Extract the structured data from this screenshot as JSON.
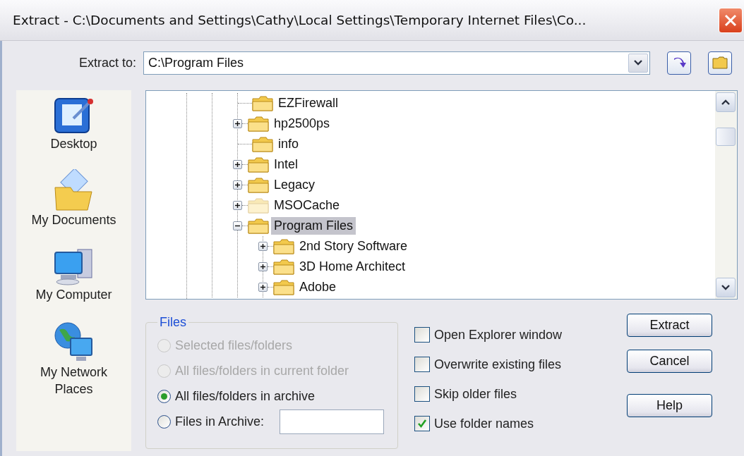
{
  "window": {
    "title": "Extract - C:\\Documents and Settings\\Cathy\\Local Settings\\Temporary Internet Files\\Co..."
  },
  "extract_to": {
    "label": "Extract to:",
    "value": "C:\\Program Files"
  },
  "places": [
    {
      "label": "Desktop",
      "kind": "desktop"
    },
    {
      "label": "My Documents",
      "kind": "documents"
    },
    {
      "label": "My Computer",
      "kind": "computer"
    },
    {
      "label": "My Network Places",
      "kind": "network"
    }
  ],
  "tree": [
    {
      "label": "EZFirewall",
      "expandable": false,
      "selected": false,
      "dimmed": false
    },
    {
      "label": "hp2500ps",
      "expandable": true,
      "expanded": false,
      "selected": false,
      "dimmed": false
    },
    {
      "label": "info",
      "expandable": false,
      "selected": false,
      "dimmed": false
    },
    {
      "label": "Intel",
      "expandable": true,
      "expanded": false,
      "selected": false,
      "dimmed": false
    },
    {
      "label": "Legacy",
      "expandable": true,
      "expanded": false,
      "selected": false,
      "dimmed": false
    },
    {
      "label": "MSOCache",
      "expandable": true,
      "expanded": false,
      "selected": false,
      "dimmed": true
    },
    {
      "label": "Program Files",
      "expandable": true,
      "expanded": true,
      "selected": true,
      "dimmed": false,
      "children": [
        {
          "label": "2nd Story Software",
          "expandable": true,
          "expanded": false,
          "selected": false,
          "dimmed": false
        },
        {
          "label": "3D Home Architect",
          "expandable": true,
          "expanded": false,
          "selected": false,
          "dimmed": false
        },
        {
          "label": "Adobe",
          "expandable": true,
          "expanded": false,
          "selected": false,
          "dimmed": false
        }
      ]
    }
  ],
  "files_group": {
    "title": "Files",
    "options": [
      {
        "label": "Selected files/folders",
        "kind": "plain",
        "selected": false,
        "disabled": true
      },
      {
        "label": "All files/folders in current folder",
        "kind": "plain",
        "selected": false,
        "disabled": true
      },
      {
        "label": "All files/folders in archive",
        "kind": "plain",
        "selected": true,
        "disabled": false
      },
      {
        "label": "Files in Archive:",
        "kind": "with_field",
        "selected": false,
        "disabled": false
      }
    ]
  },
  "options": [
    {
      "label": "Open Explorer window",
      "checked": false
    },
    {
      "label": "Overwrite existing files",
      "checked": false
    },
    {
      "label": "Skip older files",
      "checked": false
    },
    {
      "label": "Use folder names",
      "checked": true
    }
  ],
  "buttons": [
    "Extract",
    "Cancel",
    "Help"
  ]
}
